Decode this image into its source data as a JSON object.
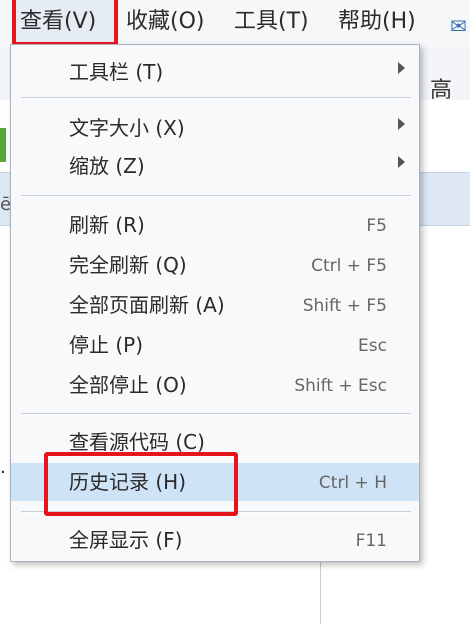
{
  "menubar": {
    "items": [
      {
        "label": "查看(V)",
        "active": true
      },
      {
        "label": "收藏(O)"
      },
      {
        "label": "工具(T)"
      },
      {
        "label": "帮助(H)"
      }
    ]
  },
  "background": {
    "right_text": "高",
    "right_icon": "mail-icon"
  },
  "menu": {
    "toolbar": {
      "label": "工具栏 (T)"
    },
    "text_size": {
      "label": "文字大小 (X)"
    },
    "zoom": {
      "label": "缩放 (Z)"
    },
    "refresh": {
      "label": "刷新 (R)",
      "shortcut": "F5"
    },
    "full_refresh": {
      "label": "完全刷新 (Q)",
      "shortcut": "Ctrl + F5"
    },
    "refresh_all": {
      "label": "全部页面刷新 (A)",
      "shortcut": "Shift + F5"
    },
    "stop": {
      "label": "停止 (P)",
      "shortcut": "Esc"
    },
    "stop_all": {
      "label": "全部停止 (O)",
      "shortcut": "Shift + Esc"
    },
    "view_source": {
      "label": "查看源代码 (C)"
    },
    "history": {
      "label": "历史记录 (H)",
      "shortcut": "Ctrl + H"
    },
    "fullscreen": {
      "label": "全屏显示 (F)",
      "shortcut": "F11"
    }
  },
  "highlight_color": "#e8141c",
  "hover_color": "#cfe3f7"
}
